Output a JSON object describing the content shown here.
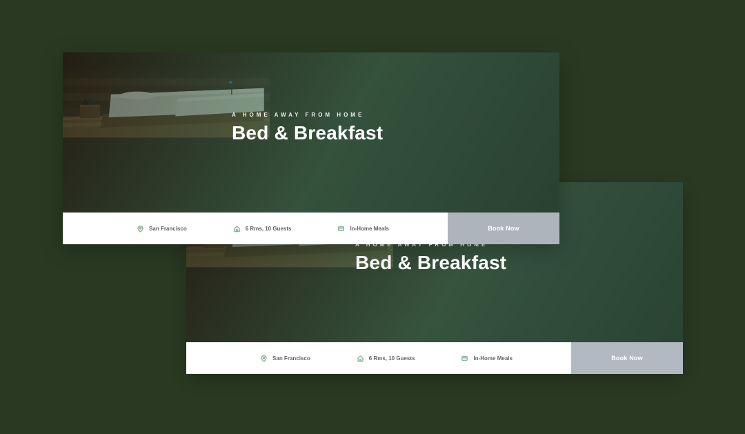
{
  "hero": {
    "pretitle": "A HOME AWAY FROM HOME",
    "title": "Bed & Breakfast"
  },
  "meta": {
    "location": "San Francisco",
    "capacity": "6 Rms, 10 Guests",
    "meals": "In-Home Meals"
  },
  "cta": {
    "label": "Book Now"
  },
  "colors": {
    "page_bg": "#2a3a22",
    "cta_bg": "#aeb4bb",
    "icon_stroke": "#8bb39a"
  }
}
